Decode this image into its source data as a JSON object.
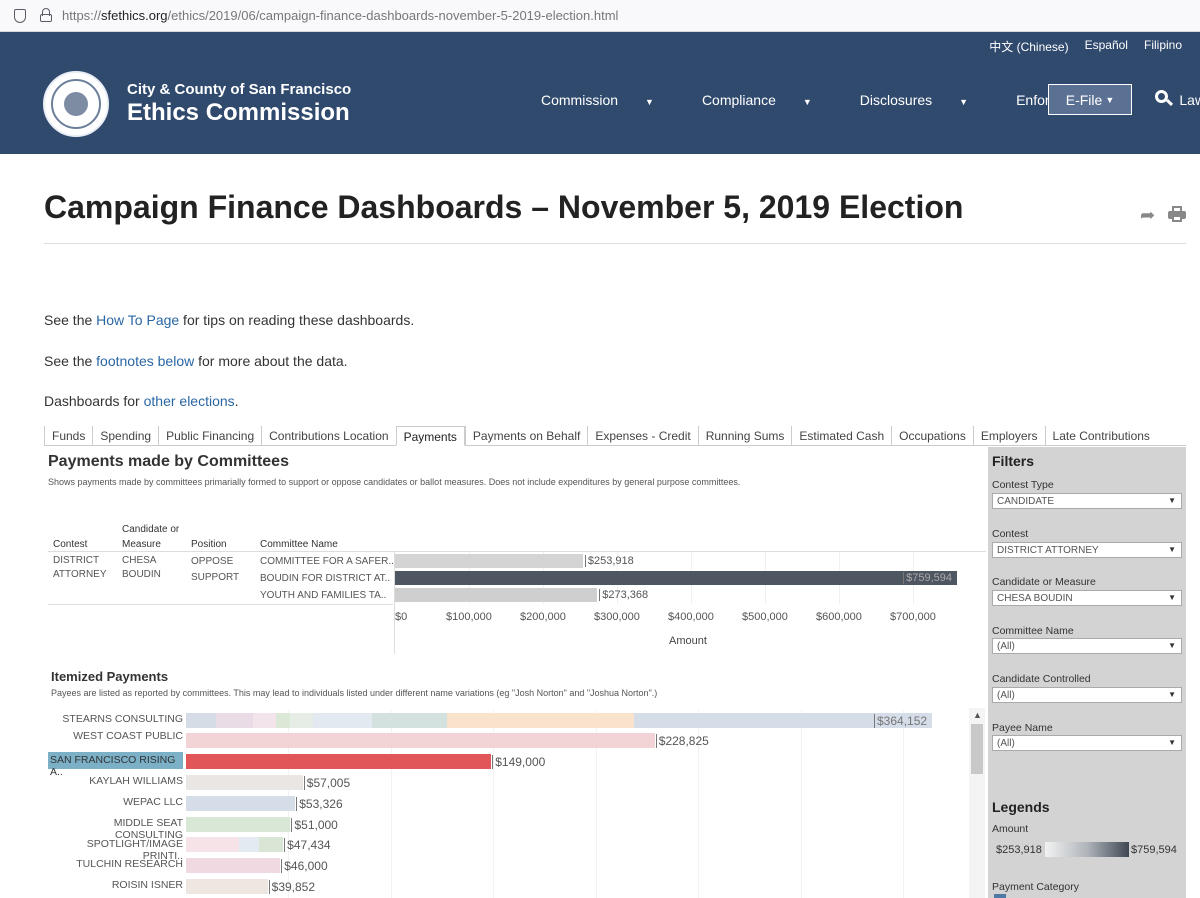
{
  "browser": {
    "url_prefix": "https://",
    "url_domain": "sfethics.org",
    "url_path": "/ethics/2019/06/campaign-finance-dashboards-november-5-2019-election.html"
  },
  "header": {
    "languages": [
      "中文 (Chinese)",
      "Español",
      "Filipino"
    ],
    "brand_line1": "City & County of San Francisco",
    "brand_line2": "Ethics Commission",
    "nav": [
      "Commission",
      "Compliance",
      "Disclosures",
      "Enforcement",
      "Laws"
    ],
    "efile_label": "E-File",
    "bg_color": "#304a6e"
  },
  "page": {
    "title": "Campaign Finance Dashboards – November 5, 2019 Election",
    "p1_pre": "See the ",
    "p1_link": "How To Page",
    "p1_post": " for tips on reading these dashboards.",
    "p2_pre": "See the ",
    "p2_link": "footnotes below",
    "p2_post": " for more about the data.",
    "p3_pre": "Dashboards for ",
    "p3_link": "other elections",
    "p3_post": "."
  },
  "tabs": [
    "Funds",
    "Spending",
    "Public Financing",
    "Contributions Location",
    "Payments",
    "Payments on Behalf",
    "Expenses - Credit",
    "Running Sums",
    "Estimated Cash",
    "Occupations",
    "Employers",
    "Late Contributions"
  ],
  "active_tab": "Payments",
  "dashboard": {
    "title": "Payments made by Committees",
    "subtitle": "Shows payments made by committees primarially formed to support or oppose candidates or ballot measures. Does not include expenditures by general purpose committees.",
    "headers": {
      "contest": "Contest",
      "candidate_line1": "Candidate or",
      "candidate_line2": "Measure",
      "position": "Position",
      "committee": "Committee Name"
    },
    "contest_line1": "DISTRICT",
    "contest_line2": "ATTORNEY",
    "candidate_line1": "CHESA",
    "candidate_line2": "BOUDIN",
    "rows": [
      {
        "position": "OPPOSE",
        "committee": "COMMITTEE FOR A SAFER..",
        "amount_label": "$253,918"
      },
      {
        "position": "SUPPORT",
        "committee": "BOUDIN FOR DISTRICT AT..",
        "amount_label": "$759,594"
      },
      {
        "position": "",
        "committee": "YOUTH AND FAMILIES TA..",
        "amount_label": "$273,368"
      }
    ],
    "axis_ticks": [
      "$0",
      "$100,000",
      "$200,000",
      "$300,000",
      "$400,000",
      "$500,000",
      "$600,000",
      "$700,000"
    ],
    "axis_title": "Amount"
  },
  "chart_data": [
    {
      "type": "bar",
      "orientation": "horizontal",
      "categories": [
        "COMMITTEE FOR A SAFER..",
        "BOUDIN FOR DISTRICT AT..",
        "YOUTH AND FAMILIES TA.."
      ],
      "values": [
        253918,
        759594,
        273368
      ],
      "xlabel": "Amount",
      "xlim": [
        0,
        760000
      ]
    },
    {
      "type": "bar",
      "orientation": "horizontal",
      "categories": [
        "STEARNS CONSULTING",
        "WEST COAST PUBLIC AFFA..",
        "SAN FRANCISCO RISING A..",
        "KAYLAH WILLIAMS",
        "WEPAC LLC",
        "MIDDLE SEAT CONSULTING",
        "SPOTLIGHT/IMAGE PRINTI..",
        "TULCHIN RESEARCH",
        "ROISIN ISNER"
      ],
      "values": [
        364152,
        228825,
        149000,
        57005,
        53326,
        51000,
        47434,
        46000,
        39852
      ]
    }
  ],
  "itemized": {
    "title": "Itemized Payments",
    "subtitle": "Payees are listed as reported by committees. This may lead to individuals listed under different name variations (eg \"Josh Norton\" and \"Joshua Norton\".)",
    "payees": [
      {
        "name": "STEARNS CONSULTING",
        "value_label": "$364,152"
      },
      {
        "name": "WEST COAST PUBLIC AFFA..",
        "value_label": "$228,825"
      },
      {
        "name": "SAN FRANCISCO RISING A..",
        "value_label": "$149,000"
      },
      {
        "name": "KAYLAH WILLIAMS",
        "value_label": "$57,005"
      },
      {
        "name": "WEPAC LLC",
        "value_label": "$53,326"
      },
      {
        "name": "MIDDLE SEAT CONSULTING",
        "value_label": "$51,000"
      },
      {
        "name": "SPOTLIGHT/IMAGE PRINTI..",
        "value_label": "$47,434"
      },
      {
        "name": "TULCHIN RESEARCH",
        "value_label": "$46,000"
      },
      {
        "name": "ROISIN ISNER",
        "value_label": "$39,852"
      }
    ]
  },
  "filters": {
    "title": "Filters",
    "items": [
      {
        "label": "Contest Type",
        "value": "CANDIDATE"
      },
      {
        "label": "Contest",
        "value": "DISTRICT ATTORNEY"
      },
      {
        "label": "Candidate or Measure",
        "value": "CHESA BOUDIN"
      },
      {
        "label": "Committee Name",
        "value": "(All)"
      },
      {
        "label": "Candidate Controlled",
        "value": "(All)"
      },
      {
        "label": "Payee Name",
        "value": "(All)"
      }
    ],
    "legends_title": "Legends",
    "legend_amount_label": "Amount",
    "legend_min": "$253,918",
    "legend_max": "$759,594",
    "payment_category_label": "Payment Category"
  },
  "colors": {
    "link": "#2966a3",
    "bar_light": "#d3d3d3",
    "bar_dark": "#4e5662",
    "selected_bar": "#e15759",
    "selected_row": "#7bb0c7"
  }
}
